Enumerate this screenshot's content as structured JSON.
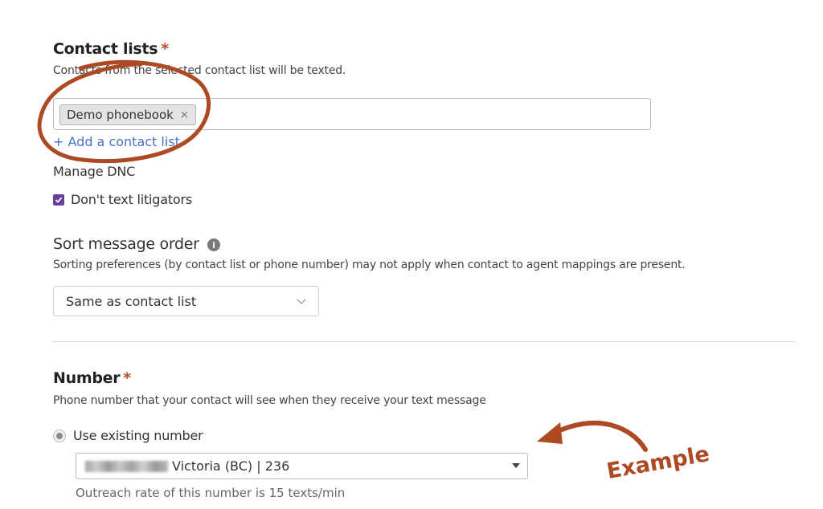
{
  "contact_lists": {
    "title": "Contact lists",
    "required_mark": "*",
    "help": "Contacts from the selected contact list will be texted.",
    "selected_chip": "Demo phonebook",
    "chip_remove": "×",
    "add_link": "+ Add a contact list"
  },
  "dnc": {
    "label": "Manage DNC",
    "checkbox_label": "Don't text litigators",
    "checked": true
  },
  "sort": {
    "title": "Sort message order",
    "info_glyph": "i",
    "help": "Sorting preferences (by contact list or phone number) may not apply when contact to agent mappings are present.",
    "selected": "Same as contact list"
  },
  "number": {
    "title": "Number",
    "required_mark": "*",
    "help": "Phone number that your contact will see when they receive your text message",
    "radio_label": "Use existing number",
    "selected_number_label": "Victoria (BC) | 236",
    "outreach_note": "Outreach rate of this number is 15 texts/min"
  },
  "annotation": {
    "text": "Example",
    "color": "#ad4a24"
  },
  "colors": {
    "checkbox": "#6b3fa0",
    "link": "#4a72c4",
    "required": "#b5532a"
  }
}
